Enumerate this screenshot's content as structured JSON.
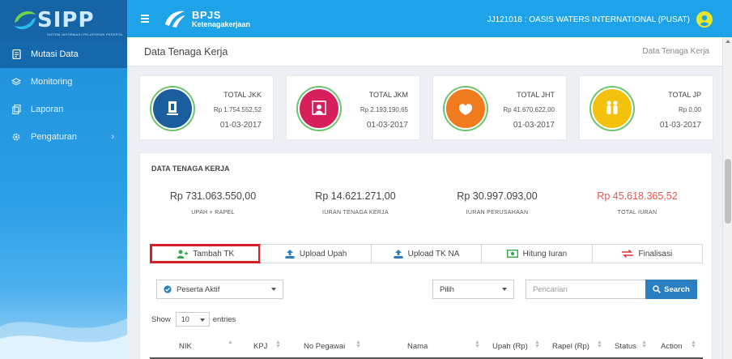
{
  "sidebar": {
    "logo_text": "SIPP",
    "logo_sub": "SISTEM INFORMASI PELAPORAN PESERTA",
    "items": [
      {
        "label": "Mutasi Data",
        "icon": "document-icon",
        "active": true
      },
      {
        "label": "Monitoring",
        "icon": "layers-icon",
        "active": false
      },
      {
        "label": "Laporan",
        "icon": "copy-icon",
        "active": false
      },
      {
        "label": "Pengaturan",
        "icon": "gear-icon",
        "active": false,
        "chevron": "›"
      }
    ]
  },
  "header": {
    "brand_line1": "BPJS",
    "brand_line2": "Ketenagakerjaan",
    "user": "JJ121018 : OASIS WATERS INTERNATIONAL (PUSAT)"
  },
  "page": {
    "title": "Data Tenaga Kerja",
    "breadcrumb": "Data Tenaga Kerja"
  },
  "cards": [
    {
      "title": "TOTAL JKK",
      "value": "Rp 1.754.552,52",
      "date": "01-03-2017",
      "color": "#1a5e9e"
    },
    {
      "title": "TOTAL JKM",
      "value": "Rp 2.193.190,65",
      "date": "01-03-2017",
      "color": "#d61f5b"
    },
    {
      "title": "TOTAL JHT",
      "value": "Rp 41.670.622,00",
      "date": "01-03-2017",
      "color": "#f07a1e"
    },
    {
      "title": "TOTAL JP",
      "value": "Rp 0,00",
      "date": "01-03-2017",
      "color": "#f4c20d"
    }
  ],
  "panel": {
    "heading": "DATA TENAGA KERJA",
    "stats": [
      {
        "value": "Rp 731.063.550,00",
        "label": "UPAH + RAPEL"
      },
      {
        "value": "Rp 14.621.271,00",
        "label": "IURAN TENAGA KERJA"
      },
      {
        "value": "Rp 30.997.093,00",
        "label": "IURAN PERUSAHAAN"
      },
      {
        "value": "Rp 45.618.365,52",
        "label": "TOTAL IURAN"
      }
    ],
    "actions": [
      {
        "label": "Tambah TK",
        "icon": "add-user-icon"
      },
      {
        "label": "Upload Upah",
        "icon": "upload-icon"
      },
      {
        "label": "Upload TK NA",
        "icon": "upload-icon"
      },
      {
        "label": "Hitung Iuran",
        "icon": "money-icon"
      },
      {
        "label": "Finalisasi",
        "icon": "exchange-icon"
      }
    ],
    "filter_status": "Peserta Aktif",
    "filter_pilih": "Pilih",
    "search_placeholder": "Pencarian",
    "search_button": "Search",
    "show_label": "Show",
    "entries_value": "10",
    "entries_label": "entries",
    "columns": [
      "NIK",
      "KPJ",
      "No Pegawai",
      "Nama",
      "Upah (Rp)",
      "Rapel (Rp)",
      "Status",
      "Action"
    ]
  },
  "colors": {
    "header": "#1fa3e8",
    "sidebar_active": "#1568ab",
    "accent_red": "#e8564f",
    "highlight": "#d4202b",
    "search_button": "#2a7fc3"
  }
}
